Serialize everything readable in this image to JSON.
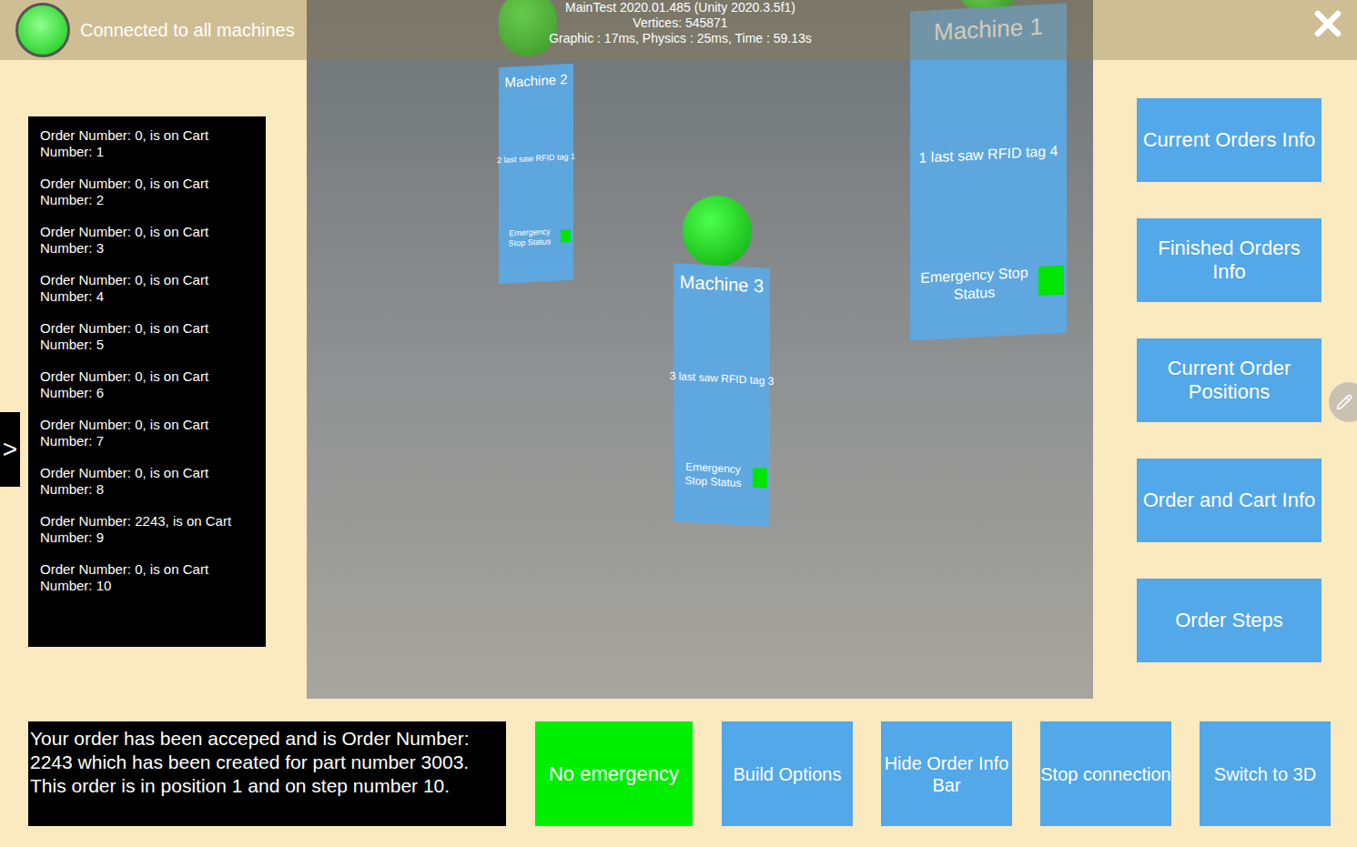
{
  "status": {
    "connected": true,
    "label": "Connected to all machines"
  },
  "debug": [
    "MainTest 2020.01.485 (Unity 2020.3.5f1)",
    "Vertices: 545871",
    "Graphic : 17ms, Physics : 25ms, Time : 59.13s"
  ],
  "side_tab": ">",
  "orders": [
    "Order Number: 0, is on Cart Number: 1",
    "Order Number: 0, is on Cart Number: 2",
    "Order Number: 0, is on Cart Number: 3",
    "Order Number: 0, is on Cart Number: 4",
    "Order Number: 0, is on Cart Number: 5",
    "Order Number: 0, is on Cart Number: 6",
    "Order Number: 0, is on Cart Number: 7",
    "Order Number: 0, is on Cart Number: 8",
    "Order Number: 2243, is on Cart Number: 9",
    "Order Number: 0, is on Cart Number: 10"
  ],
  "machines": [
    {
      "name": "Machine 2",
      "rfid": "2 last saw RFID tag 1",
      "estop_label": "Emergency Stop Status",
      "estop_ok": true,
      "connected": true
    },
    {
      "name": "Machine 3",
      "rfid": "3 last saw RFID tag 3",
      "estop_label": "Emergency Stop Status",
      "estop_ok": true,
      "connected": true
    },
    {
      "name": "Machine 1",
      "rfid": "1 last saw RFID tag 4",
      "estop_label": "Emergency Stop Status",
      "estop_ok": true,
      "connected": true
    }
  ],
  "menu": [
    "Current Orders Info",
    "Finished Orders Info",
    "Current Order Positions",
    "Order and Cart Info",
    "Order Steps"
  ],
  "message": "Your order has been acceped and is Order Number: 2243 which has been created for part number 3003. This order is in position 1 and on step number 10.",
  "emergency": {
    "label": "No emergency",
    "active": false
  },
  "buttons": [
    "Build Options",
    "Hide Order Info Bar",
    "Stop connection",
    "Switch to 3D"
  ]
}
